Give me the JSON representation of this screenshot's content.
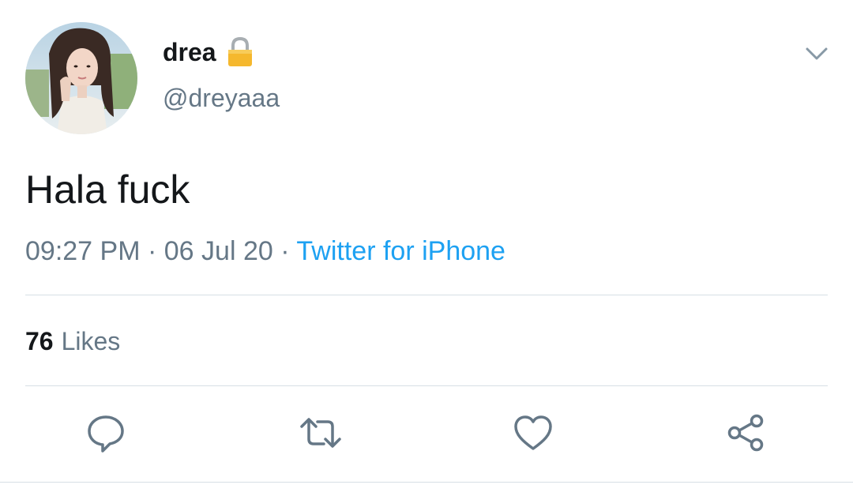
{
  "author": {
    "display_name": "drea",
    "handle": "@dreyaaa",
    "protected_icon": "lock-icon"
  },
  "tweet": {
    "text": "Hala fuck",
    "time": "09:27 PM",
    "separator": "·",
    "date": "06 Jul 20",
    "source": "Twitter for iPhone"
  },
  "stats": {
    "likes_count": "76",
    "likes_label": "Likes"
  },
  "actions": {
    "reply_icon": "speech-bubble-icon",
    "retweet_icon": "retweet-icon",
    "like_icon": "heart-icon",
    "share_icon": "share-icon"
  },
  "colors": {
    "link": "#1da1f2",
    "secondary_text": "#657786",
    "primary_text": "#14171a",
    "divider": "#d6dfe5"
  }
}
